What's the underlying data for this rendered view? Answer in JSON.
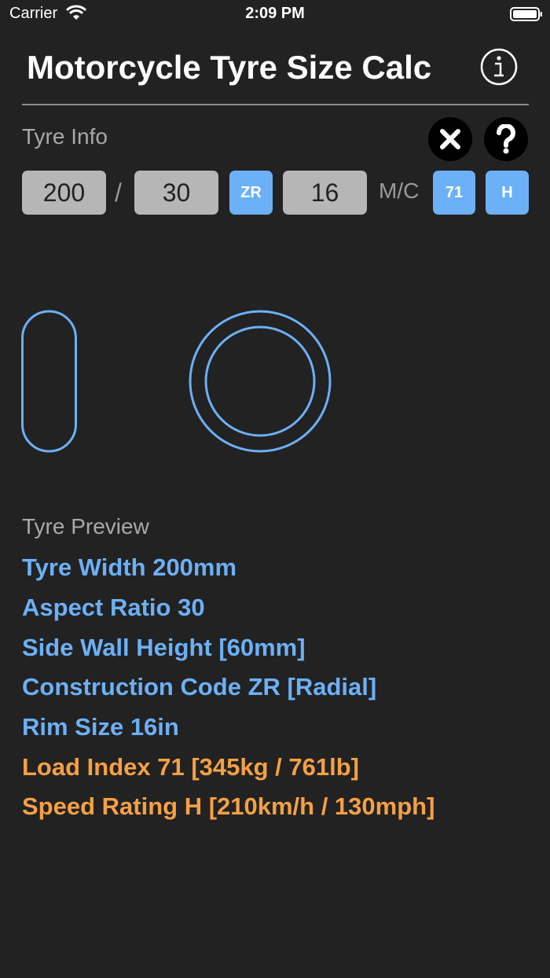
{
  "status_bar": {
    "carrier": "Carrier",
    "time": "2:09 PM"
  },
  "nav": {
    "title": "Motorcycle Tyre Size Calc",
    "info_icon": "info-icon"
  },
  "tyre_info": {
    "label": "Tyre Info",
    "width": "200",
    "slash": "/",
    "aspect": "30",
    "construction": "ZR",
    "rim": "16",
    "mc": "M/C",
    "load_index": "71",
    "speed_rating": "H",
    "clear_icon": "close-icon",
    "help_icon": "question-icon"
  },
  "preview": {
    "label": "Tyre Preview",
    "details": [
      "Tyre Width 200mm",
      "Aspect Ratio 30",
      "Side Wall Height [60mm]",
      "Construction Code ZR [Radial]",
      "Rim Size 16in",
      "Load Index 71 [345kg / 761lb]",
      "Speed Rating H [210km/h / 130mph]"
    ]
  },
  "colors": {
    "accent_blue": "#6cb0f7",
    "accent_orange": "#f5a045",
    "background": "#222222"
  }
}
